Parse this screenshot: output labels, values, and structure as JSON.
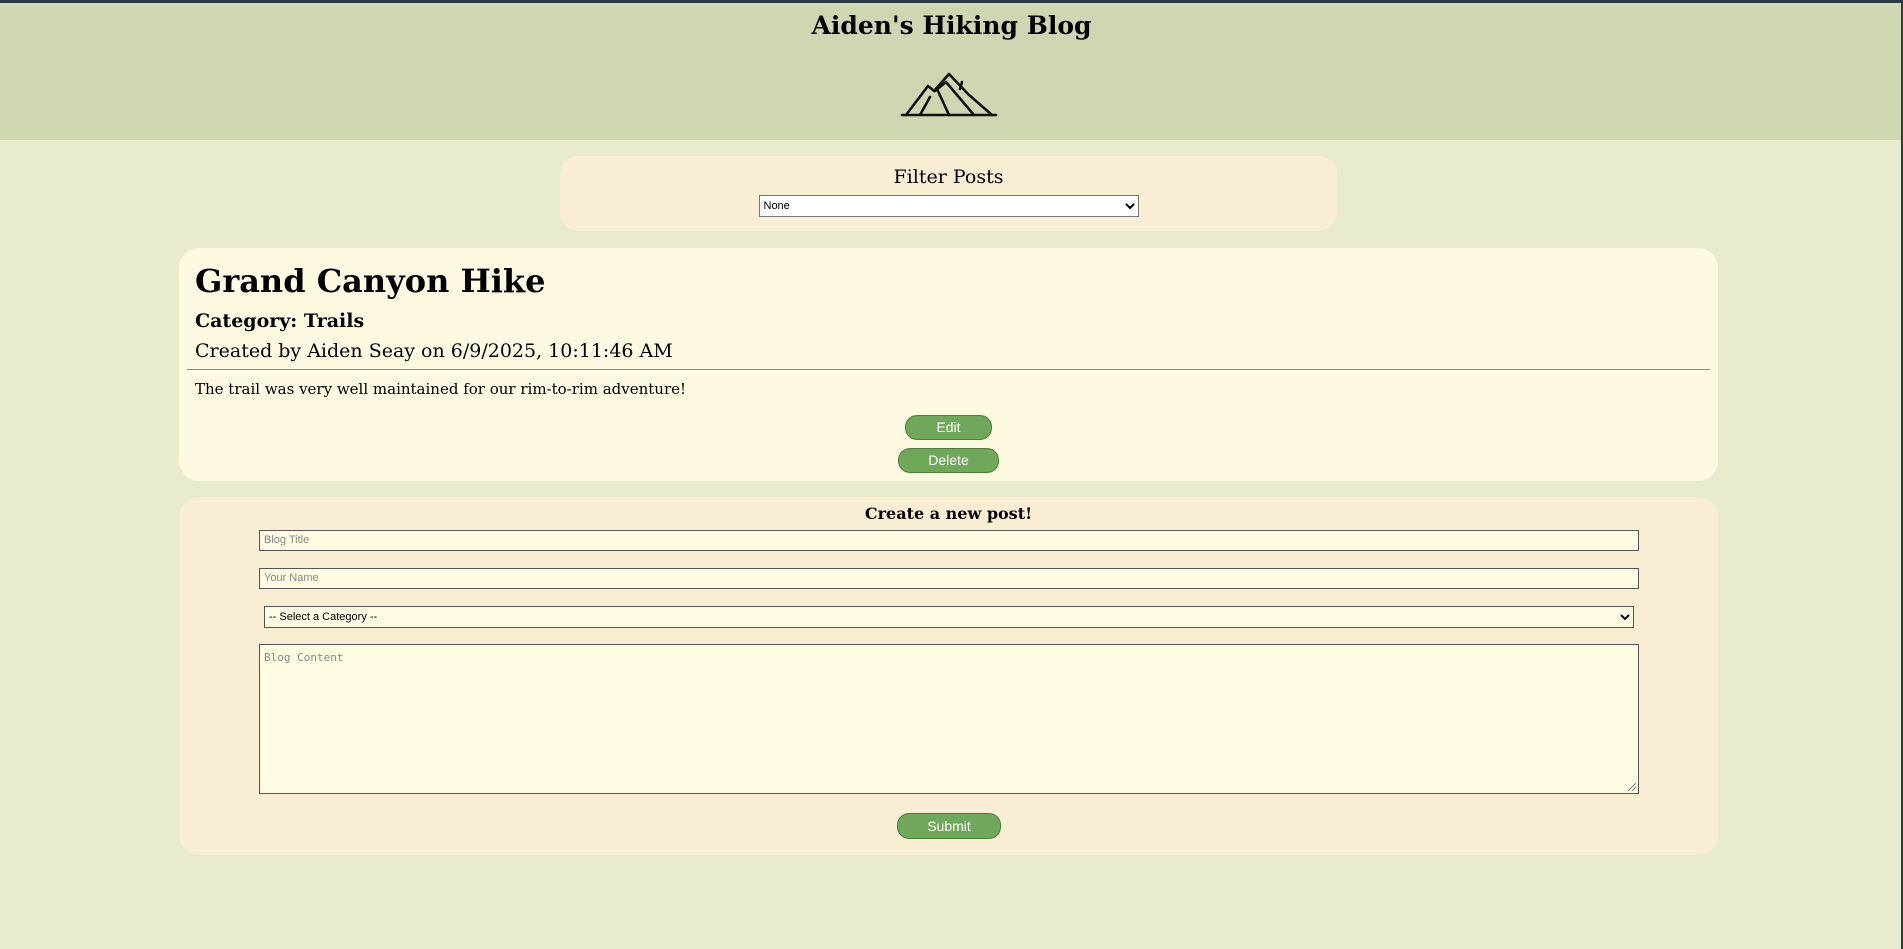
{
  "header": {
    "title": "Aiden's Hiking Blog",
    "logo_icon": "mountain-icon"
  },
  "filter": {
    "title": "Filter Posts",
    "selected": "None"
  },
  "post": {
    "title": "Grand Canyon Hike",
    "category": "Category: Trails",
    "meta": "Created by Aiden Seay on 6/9/2025, 10:11:46 AM",
    "body": "The trail was very well maintained for our rim-to-rim adventure!",
    "edit_label": "Edit",
    "delete_label": "Delete"
  },
  "create": {
    "heading": "Create a new post!",
    "title_placeholder": "Blog Title",
    "name_placeholder": "Your Name",
    "category_selected": "-- Select a Category --",
    "content_placeholder": "Blog Content",
    "submit_label": "Submit"
  },
  "colors": {
    "background": "#e8eccd",
    "header": "#cfd7b2",
    "card": "#fefae2",
    "form_card": "#f9eed3",
    "button": "#6fa85a"
  }
}
